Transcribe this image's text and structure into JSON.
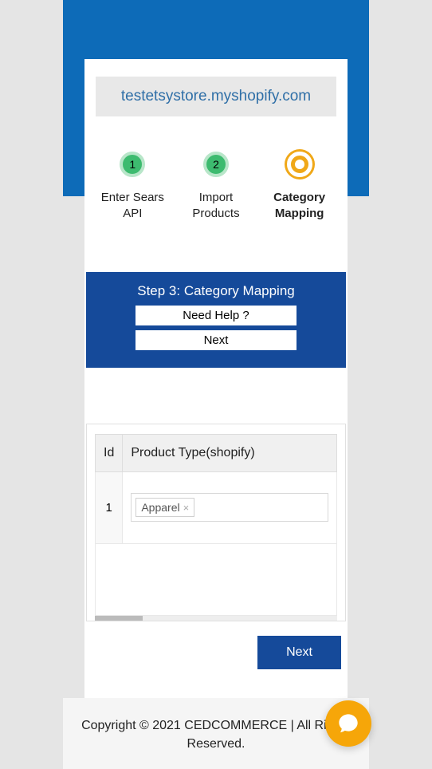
{
  "storeUrl": "testetsystore.myshopify.com",
  "steps": [
    {
      "num": "1",
      "label": "Enter Sears API"
    },
    {
      "num": "2",
      "label": "Import Products"
    },
    {
      "num": "",
      "label": "Category Mapping"
    }
  ],
  "panel": {
    "title": "Step 3: Category Mapping",
    "helpBtn": "Need Help ?",
    "nextBtn": "Next"
  },
  "table": {
    "headers": {
      "id": "Id",
      "productType": "Product Type(shopify)"
    },
    "rows": [
      {
        "id": "1",
        "tag": "Apparel"
      }
    ]
  },
  "nextButton": "Next",
  "footer": "Copyright © 2021 CEDCOMMERCE | All Rights Reserved."
}
